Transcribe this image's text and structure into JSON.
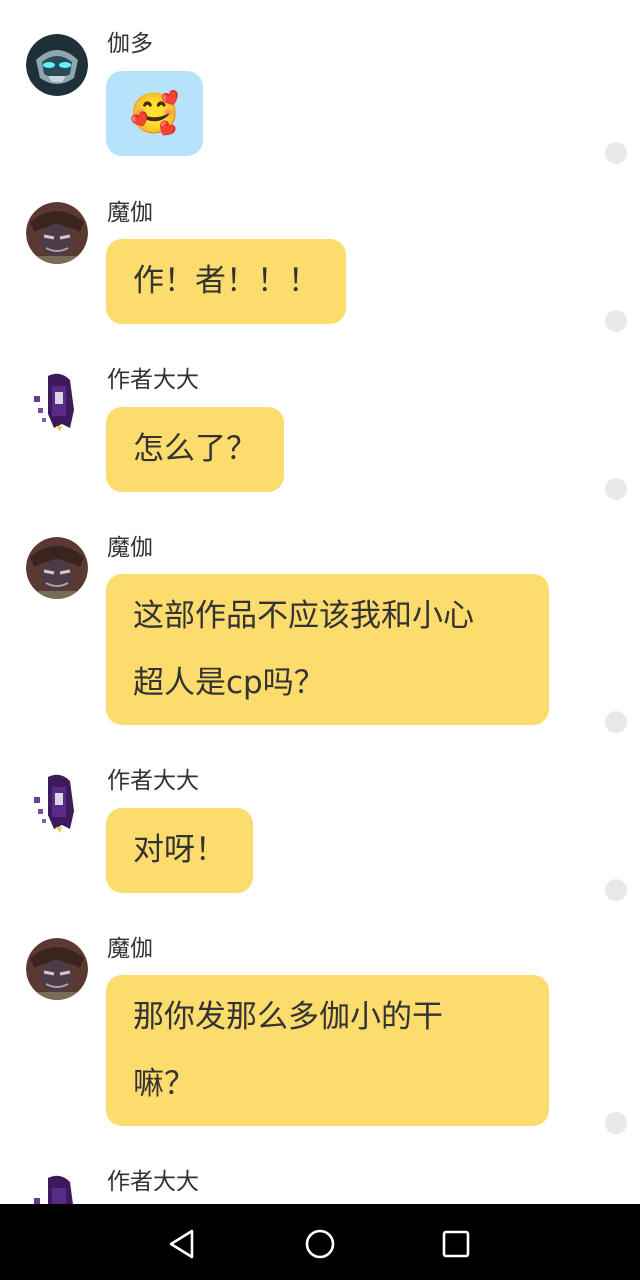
{
  "messages": [
    {
      "sender": "伽多",
      "avatar": "blue-robot-avatar",
      "bubble_color": "#b6e3fb",
      "type": "emoji",
      "emoji": "🥰"
    },
    {
      "sender": "魔伽",
      "avatar": "dark-character-avatar",
      "bubble_color": "#fddc6e",
      "type": "text",
      "lines": [
        "作！者！！！"
      ]
    },
    {
      "sender": "作者大大",
      "avatar": "purple-girl-avatar",
      "bubble_color": "#fddc6e",
      "type": "text",
      "lines": [
        "怎么了？"
      ]
    },
    {
      "sender": "魔伽",
      "avatar": "dark-character-avatar",
      "bubble_color": "#fddc6e",
      "type": "text",
      "lines": [
        "这部作品不应该我和小心",
        "超人是cp吗？"
      ]
    },
    {
      "sender": "作者大大",
      "avatar": "purple-girl-avatar",
      "bubble_color": "#fddc6e",
      "type": "text",
      "lines": [
        "对呀！"
      ]
    },
    {
      "sender": "魔伽",
      "avatar": "dark-character-avatar",
      "bubble_color": "#fddc6e",
      "type": "text",
      "lines": [
        "那你发那么多伽小的干",
        "嘛？"
      ]
    },
    {
      "sender": "作者大大",
      "avatar": "purple-girl-avatar",
      "type": "partial"
    }
  ],
  "navbar": {
    "back_icon": "triangle-back-icon",
    "home_icon": "circle-home-icon",
    "recents_icon": "square-recents-icon"
  }
}
